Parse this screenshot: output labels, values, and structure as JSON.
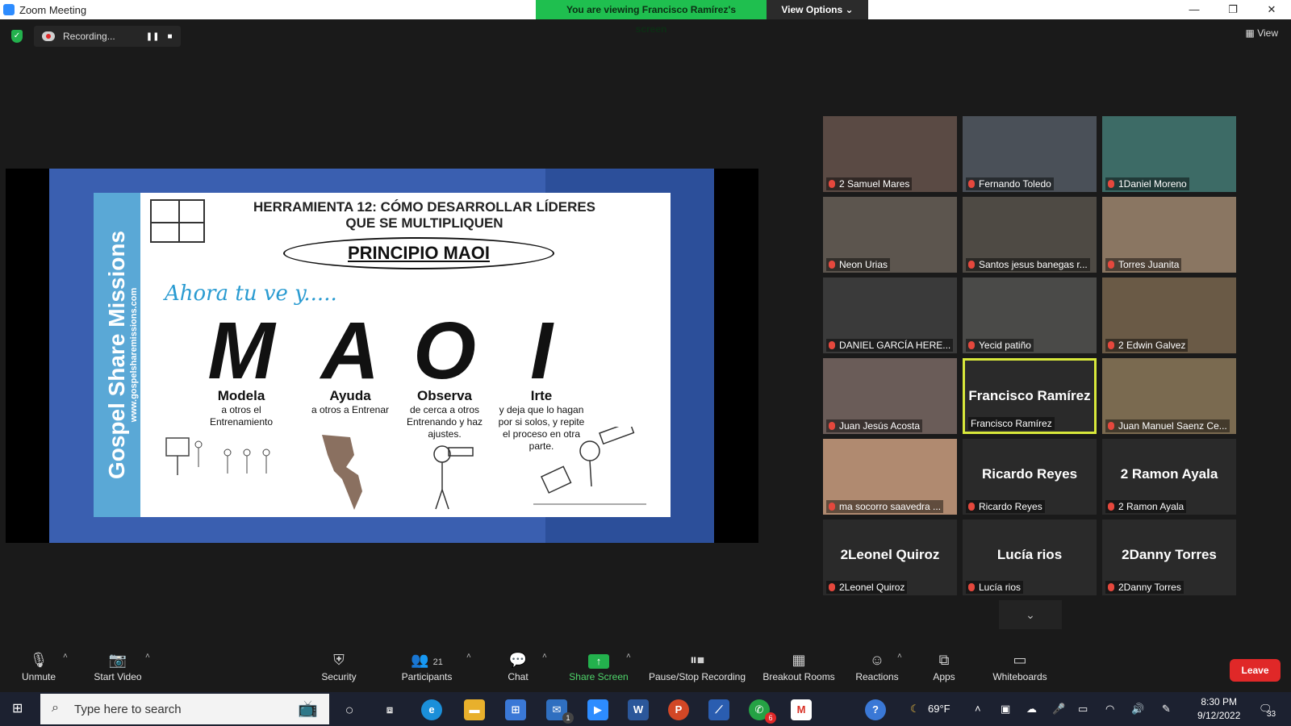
{
  "window": {
    "title": "Zoom Meeting"
  },
  "banner": {
    "message": "You are viewing Francisco Ramírez's screen",
    "options": "View Options"
  },
  "window_controls": {
    "minimize": "—",
    "restore": "❐",
    "close": "✕"
  },
  "recording": {
    "status": "Recording...",
    "pause": "❚❚",
    "stop": "■"
  },
  "view_button": "▦ View",
  "slide": {
    "side_title": "Gospel Share Missions",
    "side_url": "www.gospelsharemissions.com",
    "title_line1": "HERRAMIENTA 12:  CÓMO DESARROLLAR LÍDERES",
    "title_line2": "QUE SE MULTIPLIQUEN",
    "principle": "PRINCIPIO MAOI",
    "script": "Ahora tu ve y.....",
    "columns": [
      {
        "letter": "M",
        "word": "Modela",
        "desc": "a otros el Entrenamiento"
      },
      {
        "letter": "A",
        "word": "Ayuda",
        "desc": "a otros a Entrenar"
      },
      {
        "letter": "O",
        "word": "Observa",
        "desc": "de cerca a otros Entrenando y haz ajustes."
      },
      {
        "letter": "I",
        "word": "Irte",
        "desc": "y deja que lo hagan por si solos, y repite el proceso en otra parte."
      }
    ]
  },
  "participants": [
    {
      "name": "2 Samuel Mares",
      "big": "",
      "video": "#5a4a44"
    },
    {
      "name": "Fernando Toledo",
      "big": "",
      "video": "#4a5058"
    },
    {
      "name": "1Daniel Moreno",
      "big": "",
      "video": "#3d6b66"
    },
    {
      "name": "Neon Urias",
      "big": "",
      "video": "#5c554e"
    },
    {
      "name": "Santos jesus banegas r...",
      "big": "",
      "video": "#4e4a44"
    },
    {
      "name": "Torres Juanita",
      "big": "",
      "video": "#8a7662"
    },
    {
      "name": "DANIEL GARCÍA HERE...",
      "big": "",
      "video": "#3a3a3a"
    },
    {
      "name": "Yecid patiño",
      "big": "",
      "video": "#4a4a48"
    },
    {
      "name": "2 Edwin Galvez",
      "big": "",
      "video": "#6a5a46"
    },
    {
      "name": "Juan Jesús Acosta",
      "big": "",
      "video": "#6a5c58"
    },
    {
      "name": "Francisco Ramírez",
      "big": "Francisco Ramírez",
      "video": ""
    },
    {
      "name": "Juan Manuel Saenz Ce...",
      "big": "",
      "video": "#7a6a50"
    },
    {
      "name": "ma socorro saavedra ...",
      "big": "",
      "video": "#b08a70"
    },
    {
      "name": "Ricardo Reyes",
      "big": "Ricardo Reyes",
      "video": ""
    },
    {
      "name": "2 Ramon Ayala",
      "big": "2 Ramon Ayala",
      "video": ""
    },
    {
      "name": "2Leonel Quiroz",
      "big": "2Leonel Quiroz",
      "video": ""
    },
    {
      "name": "Lucía rios",
      "big": "Lucía rios",
      "video": ""
    },
    {
      "name": "2Danny Torres",
      "big": "2Danny Torres",
      "video": ""
    }
  ],
  "grid_more": "⌄",
  "toolbar": {
    "unmute": "Unmute",
    "start_video": "Start Video",
    "security": "Security",
    "participants": "Participants",
    "participants_count": "21",
    "chat": "Chat",
    "share_screen": "Share Screen",
    "pause_stop_recording": "Pause/Stop Recording",
    "breakout_rooms": "Breakout Rooms",
    "reactions": "Reactions",
    "apps": "Apps",
    "whiteboards": "Whiteboards",
    "leave": "Leave"
  },
  "taskbar": {
    "search_placeholder": "Type here to search",
    "weather": "69°F",
    "time": "8:30 PM",
    "date": "9/12/2022",
    "notifications": "33",
    "mail_badge": "1",
    "whatsapp_badge": "6"
  }
}
